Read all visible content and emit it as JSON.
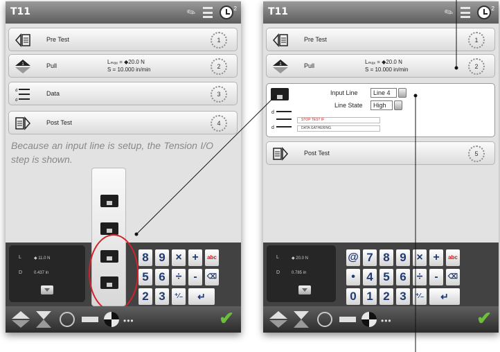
{
  "left_screen": {
    "header": {
      "title": "T11",
      "badge": "2"
    },
    "steps": [
      {
        "name": "Pre Test",
        "number": "1",
        "icon": "pre-test-icon"
      },
      {
        "name": "Pull",
        "params_line1": "Lₘₐₓ = ◆20.0 N",
        "params_line2": "S = 10.000 in/min",
        "number": "2",
        "icon": "pull-icon"
      },
      {
        "name": "Data",
        "number": "3",
        "icon": "data-icon"
      },
      {
        "name": "Post Test",
        "number": "4",
        "icon": "post-test-icon"
      }
    ],
    "caption": "Because an input line is setup, the Tension I/O step is shown.",
    "readout": {
      "l_label": "L",
      "l_value": "◆ 11.0 N",
      "d_label": "D",
      "d_value": "0.437 in"
    },
    "keys": [
      "8",
      "9",
      "×",
      "+",
      "abc",
      "5",
      "6",
      "÷",
      "-",
      "⌫",
      "2",
      "3",
      "⁺⁄₋",
      "↵"
    ]
  },
  "right_screen": {
    "header": {
      "title": "T11",
      "badge": "2"
    },
    "steps": [
      {
        "name": "Pre Test",
        "number": "1",
        "icon": "pre-test-icon"
      },
      {
        "name": "Pull",
        "params_line1": "Lₘₐₓ = ◆20.0 N",
        "params_line2": "S = 10.000 in/min",
        "number": "2",
        "icon": "pull-icon"
      },
      {
        "name": "Post Test",
        "number": "5",
        "icon": "post-test-icon"
      }
    ],
    "io_step": {
      "input_line_label": "Input Line",
      "input_line_value": "Line 4",
      "line_state_label": "Line State",
      "line_state_value": "High",
      "mini_rows": [
        "STOP TEST IF",
        "DATA GATHERING"
      ]
    },
    "readout": {
      "l_label": "L",
      "l_value": "◆ 20.0 N",
      "d_label": "D",
      "d_value": "0.785 in"
    },
    "keys": [
      "@",
      "7",
      "8",
      "9",
      "×",
      "+",
      "abc",
      "•",
      "4",
      "5",
      "6",
      "÷",
      "-",
      "⌫",
      "0",
      "1",
      "2",
      "3",
      "⁺⁄₋",
      "↵"
    ]
  },
  "colors": {
    "accent_red": "#d2222a",
    "check_green": "#6dbf3b",
    "key_text": "#1f3a72"
  }
}
